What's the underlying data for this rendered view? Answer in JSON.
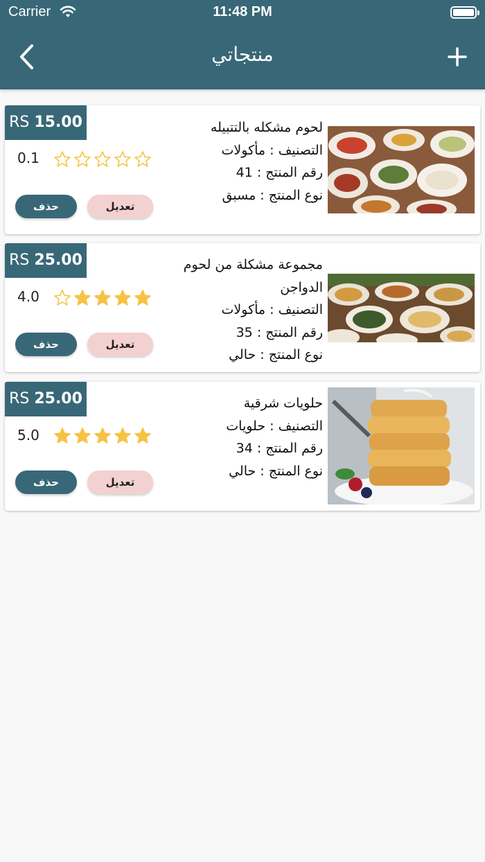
{
  "status_bar": {
    "carrier": "Carrier",
    "time": "11:48 PM"
  },
  "header": {
    "title": "منتجاتي"
  },
  "colors": {
    "primary": "#386877",
    "star": "#f7c244",
    "edit_bg": "#f4d1d1"
  },
  "products": [
    {
      "price_currency": "RS",
      "price_amount": "15.00",
      "rating": "0.1",
      "rating_fraction": 0.02,
      "name_line1": "لحوم مشكله بالتتبيله",
      "name_line2": "",
      "category": "التصنيف : مأكولات",
      "product_no": "رقم المنتج : 41",
      "product_type": "نوع المنتج : مسبق",
      "edit_label": "تعديل",
      "delete_label": "حذف",
      "image": "mixed-meat-platter"
    },
    {
      "price_currency": "RS",
      "price_amount": "25.00",
      "rating": "4.0",
      "rating_fraction": 0.8,
      "name_line1": "مجموعة مشكلة من لحوم",
      "name_line2": "الدواجن",
      "category": "التصنيف : مأكولات",
      "product_no": "رقم المنتج : 35",
      "product_type": "نوع المنتج : حالي",
      "edit_label": "تعديل",
      "delete_label": "حذف",
      "image": "poultry-dishes-spread"
    },
    {
      "price_currency": "RS",
      "price_amount": "25.00",
      "rating": "5.0",
      "rating_fraction": 1.0,
      "name_line1": "حلويات شرقية",
      "name_line2": "",
      "category": "التصنيف : حلويات",
      "product_no": "رقم المنتج : 34",
      "product_type": "نوع المنتج : حالي",
      "edit_label": "تعديل",
      "delete_label": "حذف",
      "image": "waffle-stack-dessert"
    }
  ]
}
